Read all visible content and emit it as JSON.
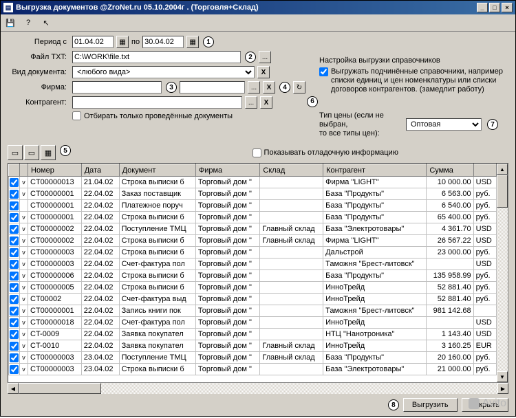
{
  "window": {
    "title": "Выгрузка документов  @ZroNet.ru 05.10.2004г .  (Торговля+Склад)"
  },
  "form": {
    "period_label": "Период с",
    "period_from": "01.04.02",
    "period_to_label": "по",
    "period_to": "30.04.02",
    "file_label": "Файл TXT:",
    "file_value": "C:\\WORK\\file.txt",
    "doctype_label": "Вид документа:",
    "doctype_value": "<любого вида>",
    "firm_label": "Фирма:",
    "firm_value": "",
    "contractor_label": "Контрагент:",
    "contractor_value": "",
    "only_posted_label": "Отбирать только проведённые документы"
  },
  "right": {
    "group_label": "Настройка выгрузки справочников",
    "export_child_label": "Выгружать подчинённые справочники, например списки единиц и цен номенклатуры или списки договоров контрагентов.  (замедлит работу)",
    "price_hint": "Тип цены (если не выбран,\nто все типы цен):",
    "price_value": "Оптовая"
  },
  "toolbar2": {
    "show_debug_label": "Показывать отладочную информацию"
  },
  "callouts": {
    "c1": "1",
    "c2": "2",
    "c3": "3",
    "c4": "4",
    "c5": "5",
    "c6": "6",
    "c7": "7",
    "c8": "8"
  },
  "table": {
    "headers": [
      "",
      "",
      "Номер",
      "Дата",
      "Документ",
      "Фирма",
      "Склад",
      "Контрагент",
      "Сумма",
      ""
    ],
    "rows": [
      {
        "chk": true,
        "v": true,
        "num": "CT00000013",
        "date": "21.04.02",
        "doc": "Строка выписки б",
        "firm": "Торговый дом \"",
        "wh": "",
        "contr": "Фирма \"LIGHT\"",
        "sum": "10 000.00",
        "cur": "USD"
      },
      {
        "chk": true,
        "v": true,
        "num": "CT00000001",
        "date": "22.04.02",
        "doc": "Заказ поставщик",
        "firm": "Торговый дом \"",
        "wh": "",
        "contr": "База \"Продукты\"",
        "sum": "6 563.00",
        "cur": "руб."
      },
      {
        "chk": true,
        "v": "",
        "num": "CT00000001",
        "date": "22.04.02",
        "doc": "Платежное поруч",
        "firm": "Торговый дом \"",
        "wh": "",
        "contr": "База \"Продукты\"",
        "sum": "6 540.00",
        "cur": "руб."
      },
      {
        "chk": true,
        "v": true,
        "num": "CT00000001",
        "date": "22.04.02",
        "doc": "Строка выписки б",
        "firm": "Торговый дом \"",
        "wh": "",
        "contr": "База \"Продукты\"",
        "sum": "65 400.00",
        "cur": "руб."
      },
      {
        "chk": true,
        "v": true,
        "num": "CT00000002",
        "date": "22.04.02",
        "doc": "Поступление ТМЦ",
        "firm": "Торговый дом \"",
        "wh": "Главный склад",
        "contr": "База \"Электротовары\"",
        "sum": "4 361.70",
        "cur": "USD"
      },
      {
        "chk": true,
        "v": true,
        "num": "CT00000002",
        "date": "22.04.02",
        "doc": "Строка выписки б",
        "firm": "Торговый дом \"",
        "wh": "Главный склад",
        "contr": "Фирма \"LIGHT\"",
        "sum": "26 567.22",
        "cur": "USD"
      },
      {
        "chk": true,
        "v": true,
        "num": "CT00000003",
        "date": "22.04.02",
        "doc": "Строка выписки б",
        "firm": "Торговый дом \"",
        "wh": "",
        "contr": "Дальстрой",
        "sum": "23 000.00",
        "cur": "руб."
      },
      {
        "chk": true,
        "v": true,
        "num": "CT00000003",
        "date": "22.04.02",
        "doc": "Счет-фактура пол",
        "firm": "Торговый дом \"",
        "wh": "",
        "contr": "Таможня \"Брест-литовск\"",
        "sum": "",
        "cur": "USD"
      },
      {
        "chk": true,
        "v": true,
        "num": "CT00000006",
        "date": "22.04.02",
        "doc": "Строка выписки б",
        "firm": "Торговый дом \"",
        "wh": "",
        "contr": "База \"Продукты\"",
        "sum": "135 958.99",
        "cur": "руб."
      },
      {
        "chk": true,
        "v": true,
        "num": "CT00000005",
        "date": "22.04.02",
        "doc": "Строка выписки б",
        "firm": "Торговый дом \"",
        "wh": "",
        "contr": "ИнноТрейд",
        "sum": "52 881.40",
        "cur": "руб."
      },
      {
        "chk": true,
        "v": true,
        "num": "CT00002",
        "date": "22.04.02",
        "doc": "Счет-фактура выд",
        "firm": "Торговый дом \"",
        "wh": "",
        "contr": "ИнноТрейд",
        "sum": "52 881.40",
        "cur": "руб."
      },
      {
        "chk": true,
        "v": true,
        "num": "CT00000001",
        "date": "22.04.02",
        "doc": "Запись книги пок",
        "firm": "Торговый дом \"",
        "wh": "",
        "contr": "Таможня \"Брест-литовск\"",
        "sum": "981 142.68",
        "cur": ""
      },
      {
        "chk": true,
        "v": true,
        "num": "CT00000018",
        "date": "22.04.02",
        "doc": "Счет-фактура пол",
        "firm": "Торговый дом \"",
        "wh": "",
        "contr": "ИнноТрейд",
        "sum": "",
        "cur": "USD"
      },
      {
        "chk": true,
        "v": true,
        "num": "CT-0009",
        "date": "22.04.02",
        "doc": "Заявка покупател",
        "firm": "Торговый дом \"",
        "wh": "",
        "contr": "НТЦ \"Нанотроника\"",
        "sum": "1 143.40",
        "cur": "USD"
      },
      {
        "chk": true,
        "v": true,
        "num": "CT-0010",
        "date": "22.04.02",
        "doc": "Заявка покупател",
        "firm": "Торговый дом \"",
        "wh": "Главный склад",
        "contr": "ИнноТрейд",
        "sum": "3 160.25",
        "cur": "EUR"
      },
      {
        "chk": true,
        "v": true,
        "num": "CT00000003",
        "date": "23.04.02",
        "doc": "Поступление ТМЦ",
        "firm": "Торговый дом \"",
        "wh": "Главный склад",
        "contr": "База \"Продукты\"",
        "sum": "20 160.00",
        "cur": "руб."
      },
      {
        "chk": true,
        "v": true,
        "num": "CT00000003",
        "date": "23.04.02",
        "doc": "Строка выписки б",
        "firm": "Торговый дом \"",
        "wh": "",
        "contr": "База \"Электротовары\"",
        "sum": "21 000.00",
        "cur": "руб."
      }
    ]
  },
  "footer": {
    "export_btn": "Выгрузить",
    "close_btn": "Закрыть"
  },
  "watermark": "Avito"
}
